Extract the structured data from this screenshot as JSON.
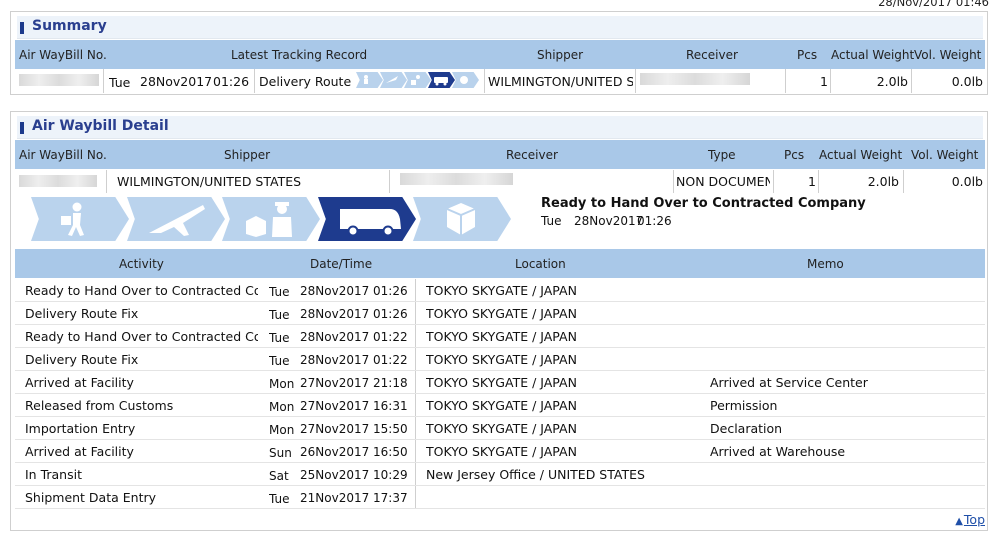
{
  "timestamp": "28/Nov/2017 01:46",
  "summary": {
    "title": "Summary",
    "headers": {
      "awb": "Air WayBill No.",
      "latest": "Latest Tracking Record",
      "shipper": "Shipper",
      "receiver": "Receiver",
      "pcs": "Pcs",
      "actual_weight": "Actual Weight",
      "vol_weight": "Vol. Weight"
    },
    "row": {
      "day": "Tue",
      "date": "28Nov2017",
      "time": "01:26",
      "status": "Delivery Route",
      "shipper": "WILMINGTON/UNITED STATES",
      "pcs": "1",
      "actual_weight": "2.0lb",
      "vol_weight": "0.0lb"
    }
  },
  "detail": {
    "title": "Air Waybill Detail",
    "headers": {
      "awb": "Air WayBill No.",
      "shipper": "Shipper",
      "receiver": "Receiver",
      "type": "Type",
      "pcs": "Pcs",
      "actual_weight": "Actual Weight",
      "vol_weight": "Vol. Weight"
    },
    "row": {
      "shipper": "WILMINGTON/UNITED STATES",
      "type": "NON DOCUMENT",
      "pcs": "1",
      "actual_weight": "2.0lb",
      "vol_weight": "0.0lb"
    },
    "progress": {
      "current_step": 4,
      "steps": [
        "pickup-person-icon",
        "airplane-icon",
        "customs-officer-icon",
        "delivery-truck-icon",
        "delivered-box-icon"
      ],
      "active_color": "#1e3b8e",
      "inactive_color": "#bad3ed",
      "status": "Ready to Hand Over to Contracted Company",
      "day": "Tue",
      "date": "28Nov2017",
      "time": "01:26"
    },
    "activity_headers": {
      "activity": "Activity",
      "datetime": "Date/Time",
      "location": "Location",
      "memo": "Memo"
    },
    "activities": [
      {
        "activity": "Ready to Hand Over to Contracted Company",
        "day": "Tue",
        "date": "28Nov2017",
        "time": "01:26",
        "location": "TOKYO SKYGATE / JAPAN",
        "memo": ""
      },
      {
        "activity": "Delivery Route Fix",
        "day": "Tue",
        "date": "28Nov2017",
        "time": "01:26",
        "location": "TOKYO SKYGATE / JAPAN",
        "memo": ""
      },
      {
        "activity": "Ready to Hand Over to Contracted Company",
        "day": "Tue",
        "date": "28Nov2017",
        "time": "01:22",
        "location": "TOKYO SKYGATE / JAPAN",
        "memo": ""
      },
      {
        "activity": "Delivery Route Fix",
        "day": "Tue",
        "date": "28Nov2017",
        "time": "01:22",
        "location": "TOKYO SKYGATE / JAPAN",
        "memo": ""
      },
      {
        "activity": "Arrived at Facility",
        "day": "Mon",
        "date": "27Nov2017",
        "time": "21:18",
        "location": "TOKYO SKYGATE / JAPAN",
        "memo": "Arrived at Service Center"
      },
      {
        "activity": "Released from Customs",
        "day": "Mon",
        "date": "27Nov2017",
        "time": "16:31",
        "location": "TOKYO SKYGATE / JAPAN",
        "memo": "Permission"
      },
      {
        "activity": "Importation Entry",
        "day": "Mon",
        "date": "27Nov2017",
        "time": "15:50",
        "location": "TOKYO SKYGATE / JAPAN",
        "memo": "Declaration"
      },
      {
        "activity": "Arrived at Facility",
        "day": "Sun",
        "date": "26Nov2017",
        "time": "16:50",
        "location": "TOKYO SKYGATE / JAPAN",
        "memo": "Arrived at Warehouse"
      },
      {
        "activity": "In Transit",
        "day": "Sat",
        "date": "25Nov2017",
        "time": "10:29",
        "location": "New Jersey Office / UNITED STATES",
        "memo": ""
      },
      {
        "activity": "Shipment Data Entry",
        "day": "Tue",
        "date": "21Nov2017",
        "time": "17:37",
        "location": "",
        "memo": ""
      }
    ]
  },
  "footer": {
    "top_label": "Top"
  }
}
